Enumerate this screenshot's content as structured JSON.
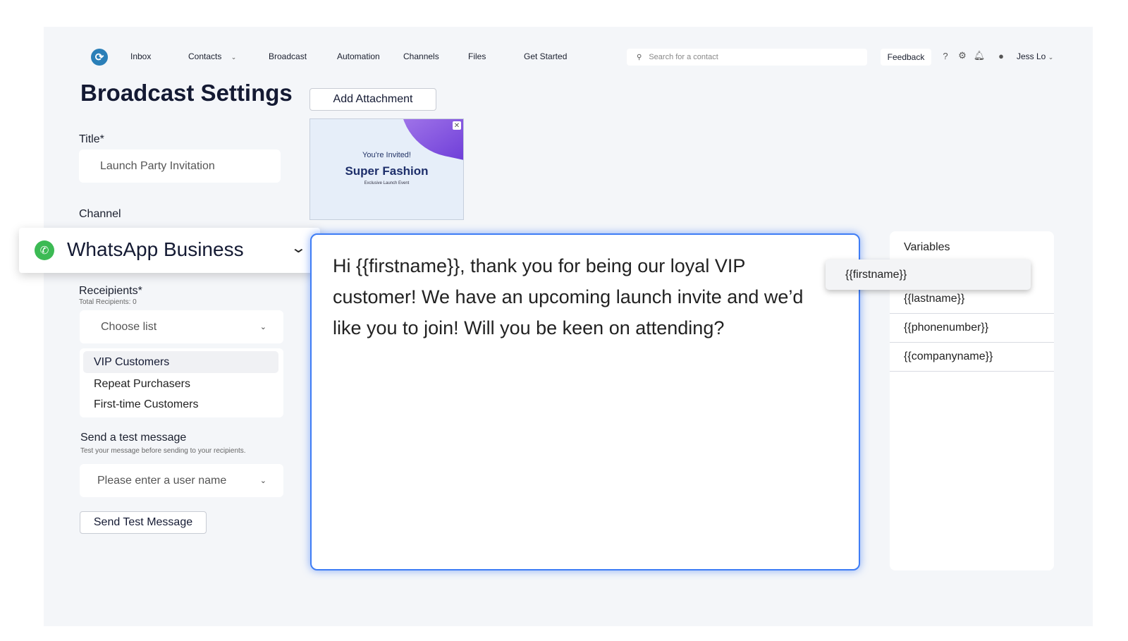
{
  "nav": {
    "items": [
      "Inbox",
      "Contacts",
      "Broadcast",
      "Automation",
      "Channels",
      "Files",
      "Get Started"
    ],
    "search_placeholder": "Search for a contact",
    "feedback_label": "Feedback",
    "user_name": "Jess Lo"
  },
  "page": {
    "title": "Broadcast Settings",
    "add_attachment_label": "Add Attachment"
  },
  "form": {
    "title_label": "Title*",
    "title_value": "Launch Party Invitation",
    "channel_label": "Channel",
    "channel_value": "WhatsApp Business",
    "recipients_label": "Receipients*",
    "recipients_total": "Total Recipients: 0",
    "choose_list_placeholder": "Choose list",
    "lists": [
      "VIP Customers",
      "Repeat Purchasers",
      "First-time Customers"
    ],
    "test_label": "Send a test message",
    "test_sub": "Test your message before sending to your recipients.",
    "test_user_placeholder": "Please enter a user name",
    "send_test_label": "Send Test Message"
  },
  "attachment": {
    "invited": "You're Invited!",
    "brand": "Super Fashion",
    "small_text": "Exclusive Launch Event"
  },
  "editor": {
    "message": "Hi {{firstname}}, thank you for being our loyal VIP customer! We have an upcoming launch invite and we’d like you to join! Will you be keen on attending?"
  },
  "variables": {
    "title": "Variables",
    "dragging": "{{firstname}}",
    "items": [
      "{{lastname}}",
      "{{phonenumber}}",
      "{{companyname}}"
    ]
  },
  "colors": {
    "accent": "#3f7df5",
    "whatsapp": "#3cba54",
    "title": "#141a33"
  }
}
